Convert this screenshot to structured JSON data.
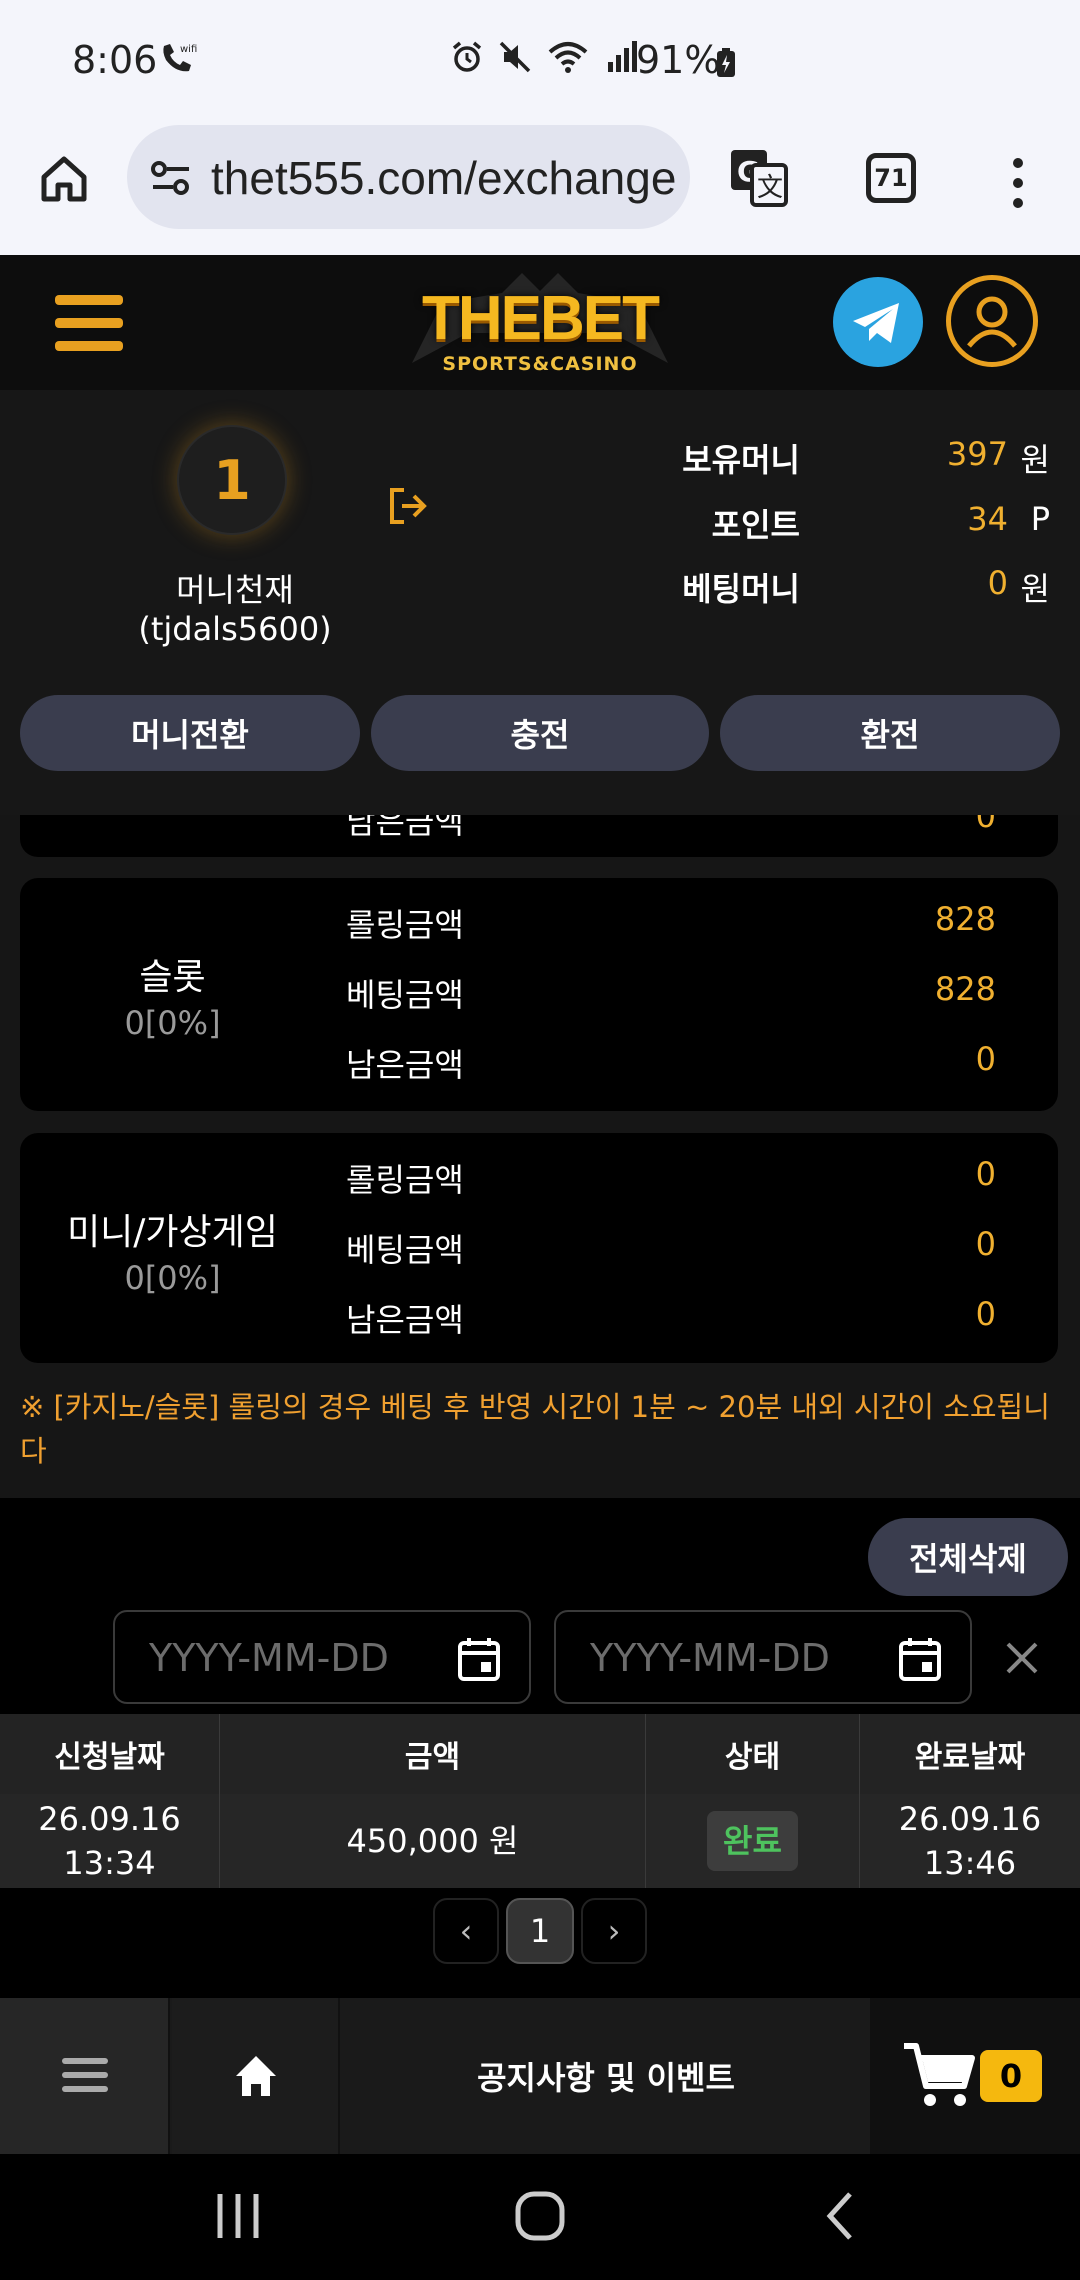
{
  "status_bar": {
    "time": "8:06",
    "battery": "91%"
  },
  "browser": {
    "url": "thet555.com/exchange",
    "tab_count": "71"
  },
  "header": {
    "logo_main": "THEBET",
    "logo_sub": "SPORTS&CASINO",
    "accent_color": "#e8a020"
  },
  "account": {
    "level": "1",
    "nickname": "머니천재",
    "user_id": "(tjdals5600)",
    "balances": [
      {
        "label": "보유머니",
        "value": "397",
        "unit": "원"
      },
      {
        "label": "포인트",
        "value": "34",
        "unit": "P"
      },
      {
        "label": "베팅머니",
        "value": "0",
        "unit": "원"
      }
    ],
    "buttons": [
      "머니전환",
      "충전",
      "환전"
    ]
  },
  "rolling": {
    "partial_row": {
      "label": "남은금액",
      "value": "0"
    },
    "cards": [
      {
        "title": "슬롯",
        "percent": "0[0%]",
        "rows": [
          {
            "label": "롤링금액",
            "value": "828"
          },
          {
            "label": "베팅금액",
            "value": "828"
          },
          {
            "label": "남은금액",
            "value": "0"
          }
        ]
      },
      {
        "title": "미니/가상게임",
        "percent": "0[0%]",
        "rows": [
          {
            "label": "롤링금액",
            "value": "0"
          },
          {
            "label": "베팅금액",
            "value": "0"
          },
          {
            "label": "남은금액",
            "value": "0"
          }
        ]
      }
    ],
    "notice": "※ [카지노/슬롯] 롤링의 경우 베팅 후 반영 시간이 1분 ~ 20분 내외 시간이 소요됩니다"
  },
  "history": {
    "delete_all_label": "전체삭제",
    "date_placeholder": "YYYY-MM-DD",
    "columns": [
      "신청날짜",
      "금액",
      "상태",
      "완료날짜"
    ],
    "rows": [
      {
        "request_date": "26.09.16",
        "request_time": "13:34",
        "amount": "450,000 원",
        "status": "완료",
        "done_date": "26.09.16",
        "done_time": "13:46"
      }
    ],
    "pagination": {
      "current": "1",
      "prev": "‹",
      "next": "›"
    }
  },
  "bottom_nav": {
    "notice_label": "공지사항 및 이벤트",
    "cart_count": "0"
  }
}
